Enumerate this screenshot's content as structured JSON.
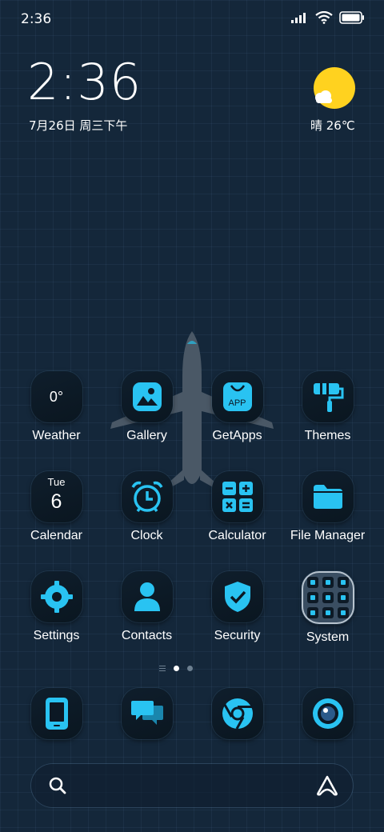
{
  "status": {
    "time": "2:36"
  },
  "clock_widget": {
    "time": "2:36",
    "date": "7月26日 周三下午"
  },
  "weather_widget": {
    "text": "晴 26℃"
  },
  "rows": [
    [
      {
        "label": "Weather",
        "icon": "weather-icon",
        "value": "0°"
      },
      {
        "label": "Gallery",
        "icon": "gallery-icon"
      },
      {
        "label": "GetApps",
        "icon": "getapps-icon",
        "badge": "APP"
      },
      {
        "label": "Themes",
        "icon": "themes-icon"
      }
    ],
    [
      {
        "label": "Calendar",
        "icon": "calendar-icon",
        "day": "Tue",
        "date": "6"
      },
      {
        "label": "Clock",
        "icon": "alarm-clock-icon"
      },
      {
        "label": "Calculator",
        "icon": "calculator-icon"
      },
      {
        "label": "File Manager",
        "icon": "folder-icon"
      }
    ],
    [
      {
        "label": "Settings",
        "icon": "gear-icon"
      },
      {
        "label": "Contacts",
        "icon": "contacts-icon"
      },
      {
        "label": "Security",
        "icon": "shield-icon"
      },
      {
        "label": "System",
        "icon": "folder-grid-icon"
      }
    ]
  ],
  "dock": [
    "phone-icon",
    "messages-icon",
    "browser-icon",
    "camera-icon"
  ],
  "colors": {
    "accent": "#29c3f2",
    "background": "#14273a",
    "sun": "#ffd21f"
  }
}
